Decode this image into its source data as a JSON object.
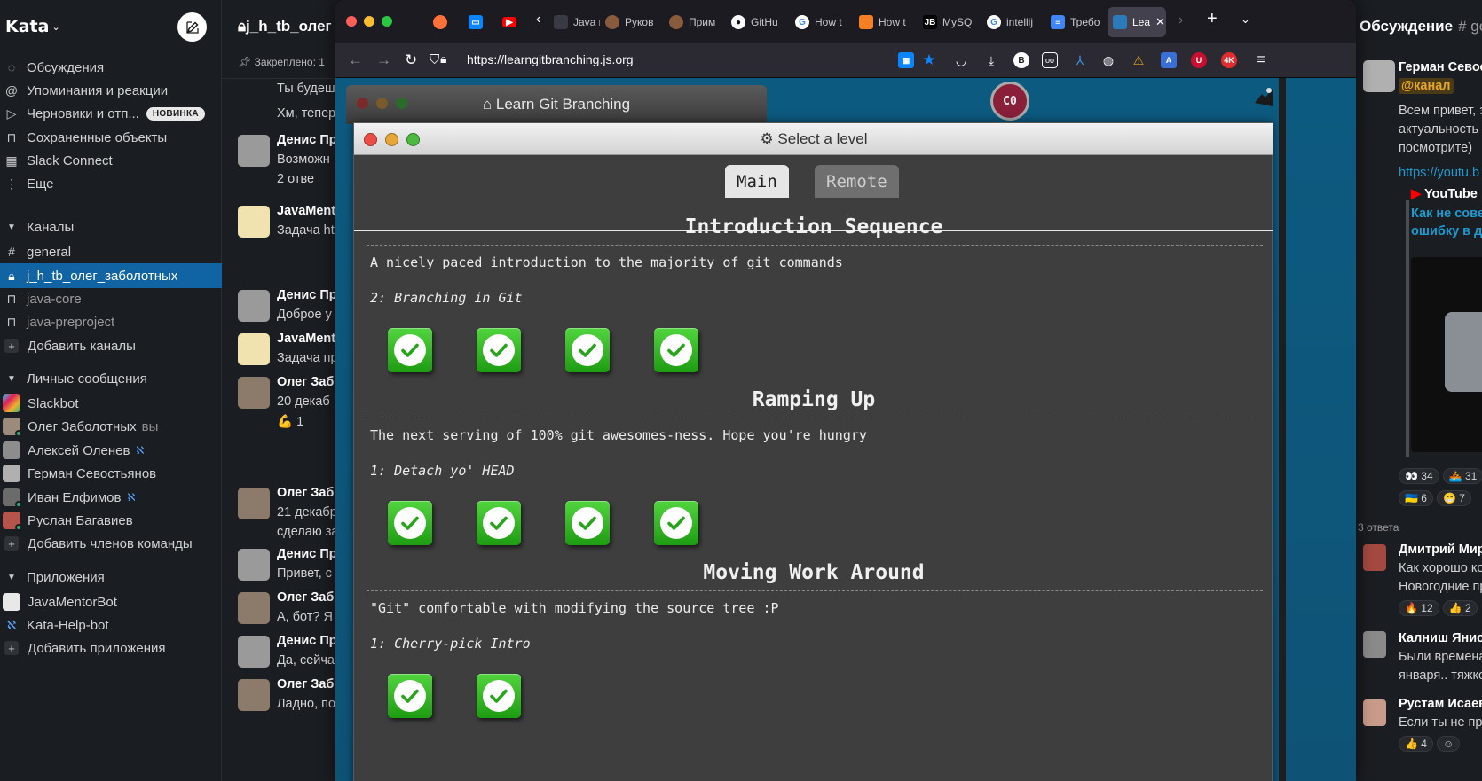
{
  "slack": {
    "workspace": "Kata",
    "nav": [
      {
        "label": "Обсуждения",
        "icon": "threads-icon"
      },
      {
        "label": "Упоминания и реакции",
        "icon": "at-icon"
      },
      {
        "label": "Черновики и отп...",
        "icon": "send-icon",
        "badge": "НОВИНКА"
      },
      {
        "label": "Сохраненные объекты",
        "icon": "bookmark-icon"
      },
      {
        "label": "Slack Connect",
        "icon": "building-icon"
      },
      {
        "label": "Еще",
        "icon": "more-icon"
      }
    ],
    "channels_header": "Каналы",
    "channels": [
      {
        "label": "general",
        "icon": "hash-icon"
      },
      {
        "label": "j_h_tb_олег_заболотных",
        "icon": "lock-icon",
        "active": true
      },
      {
        "label": "java-core",
        "icon": "lock-icon"
      },
      {
        "label": "java-preproject",
        "icon": "lock-icon"
      }
    ],
    "add_channels": "Добавить каналы",
    "dm_header": "Личные сообщения",
    "dms": [
      {
        "label": "Slackbot"
      },
      {
        "label": "Олег Заболотных",
        "suffix": "вы"
      },
      {
        "label": "Алексей Оленев"
      },
      {
        "label": "Герман Севостьянов"
      },
      {
        "label": "Иван Елфимов"
      },
      {
        "label": "Руслан Багавиев"
      }
    ],
    "add_members": "Добавить членов команды",
    "apps_header": "Приложения",
    "apps": [
      {
        "label": "JavaMentorBot"
      },
      {
        "label": "Kata-Help-bot"
      }
    ],
    "add_apps": "Добавить приложения",
    "mid": {
      "title": "j_h_tb_олег",
      "pinned": "Закреплено: 1",
      "messages": [
        {
          "name": "",
          "text": "Ты будеш"
        },
        {
          "name": "",
          "text": "Хм, тепер"
        },
        {
          "name": "Денис Пр",
          "text": "Возможн",
          "extra": "2 отве"
        },
        {
          "name": "JavaMent",
          "text": "Задача ht"
        },
        {
          "name": "Денис Пр",
          "text": "Доброе у"
        },
        {
          "name": "JavaMent",
          "text": "Задача пр"
        },
        {
          "name": "Олег Заб",
          "text": "20 декаб",
          "extra": "1"
        },
        {
          "name": "Олег Заб",
          "text": "21 декабр",
          "extra": "сделаю за"
        },
        {
          "name": "Денис Пр",
          "text": "Привет, с"
        },
        {
          "name": "Олег Заб",
          "text": "А, бот? Я"
        },
        {
          "name": "Денис Пр",
          "text": "Да, сейча"
        },
        {
          "name": "Олег Заб",
          "text": "Ладно, по"
        }
      ]
    },
    "thread": {
      "title": "Обсуждение",
      "channel": "# ge",
      "author": "Герман Севост",
      "mention": "@канал",
      "lines": [
        "Всем привет, з",
        "актуальность",
        "посмотрите)"
      ],
      "link": "https://youtu.b",
      "yt_source": "YouTube",
      "yt_title": [
        "Как не совер",
        "ошибку в де"
      ],
      "reactions_1": [
        {
          "emoji": "👀",
          "count": "34"
        },
        {
          "emoji": "🚣",
          "count": "31"
        }
      ],
      "reactions_2": [
        {
          "emoji": "🇺🇦",
          "count": "6"
        },
        {
          "emoji": "😁",
          "count": "7"
        }
      ],
      "replies": "3 ответа",
      "replies_list": [
        {
          "name": "Дмитрий Мир",
          "lines": [
            "Как хорошо ко",
            "Новогодние пр"
          ],
          "reactions": [
            {
              "emoji": "🔥",
              "count": "12"
            },
            {
              "emoji": "👍",
              "count": "2"
            }
          ]
        },
        {
          "name": "Калниш Янис",
          "lines": [
            "Были времена",
            "января.. тяжко"
          ]
        },
        {
          "name": "Рустам Исаев",
          "lines": [
            "Если ты не пра"
          ],
          "reactions": [
            {
              "emoji": "👍",
              "count": "4"
            }
          ]
        }
      ]
    }
  },
  "browser": {
    "tabs": [
      {
        "label": "",
        "icon": "firefox-icon",
        "color": "#ff7139"
      },
      {
        "label": "",
        "icon": "chat-icon",
        "color": "#0a84ff"
      },
      {
        "label": "",
        "icon": "youtube-icon",
        "color": "#ff0000"
      },
      {
        "label": "Java и",
        "icon": "tab-icon",
        "color": "#555"
      },
      {
        "label": "Руков",
        "icon": "tab-icon",
        "color": "#8a5a3c"
      },
      {
        "label": "Прим",
        "icon": "tab-icon",
        "color": "#8a5a3c"
      },
      {
        "label": "GitHu",
        "icon": "github-icon",
        "color": "#333"
      },
      {
        "label": "How t",
        "icon": "google-icon",
        "color": "#4285f4"
      },
      {
        "label": "How t",
        "icon": "stackoverflow-icon",
        "color": "#f48024"
      },
      {
        "label": "MySQ",
        "icon": "jetbrains-icon",
        "color": "#000"
      },
      {
        "label": "intellij",
        "icon": "google-icon",
        "color": "#4285f4"
      },
      {
        "label": "Требо",
        "icon": "docs-icon",
        "color": "#4285f4"
      },
      {
        "label": "Lea",
        "icon": "lgb-icon",
        "color": "#2a7bb8",
        "active": true
      }
    ],
    "url_prefix": "https://",
    "url_host": "learngitbranching.js.org"
  },
  "page": {
    "behind_title": "Learn Git Branching",
    "avatar_text": "C0",
    "modal_title": "Select a level",
    "tabs": [
      "Main",
      "Remote"
    ],
    "active_tab": "Main",
    "sequences": [
      {
        "title": "Introduction Sequence",
        "desc": "A nicely paced introduction to the majority of git commands",
        "sub": "2: Branching in Git",
        "levels": 4,
        "completed": 4
      },
      {
        "title": "Ramping Up",
        "desc": "The next serving of 100% git awesomes-ness. Hope you're hungry",
        "sub": "1: Detach yo' HEAD",
        "levels": 4,
        "completed": 4
      },
      {
        "title": "Moving Work Around",
        "desc": "\"Git\" comfortable with modifying the source tree :P",
        "sub": "1: Cherry-pick Intro",
        "levels": 2,
        "completed": 2
      }
    ]
  }
}
